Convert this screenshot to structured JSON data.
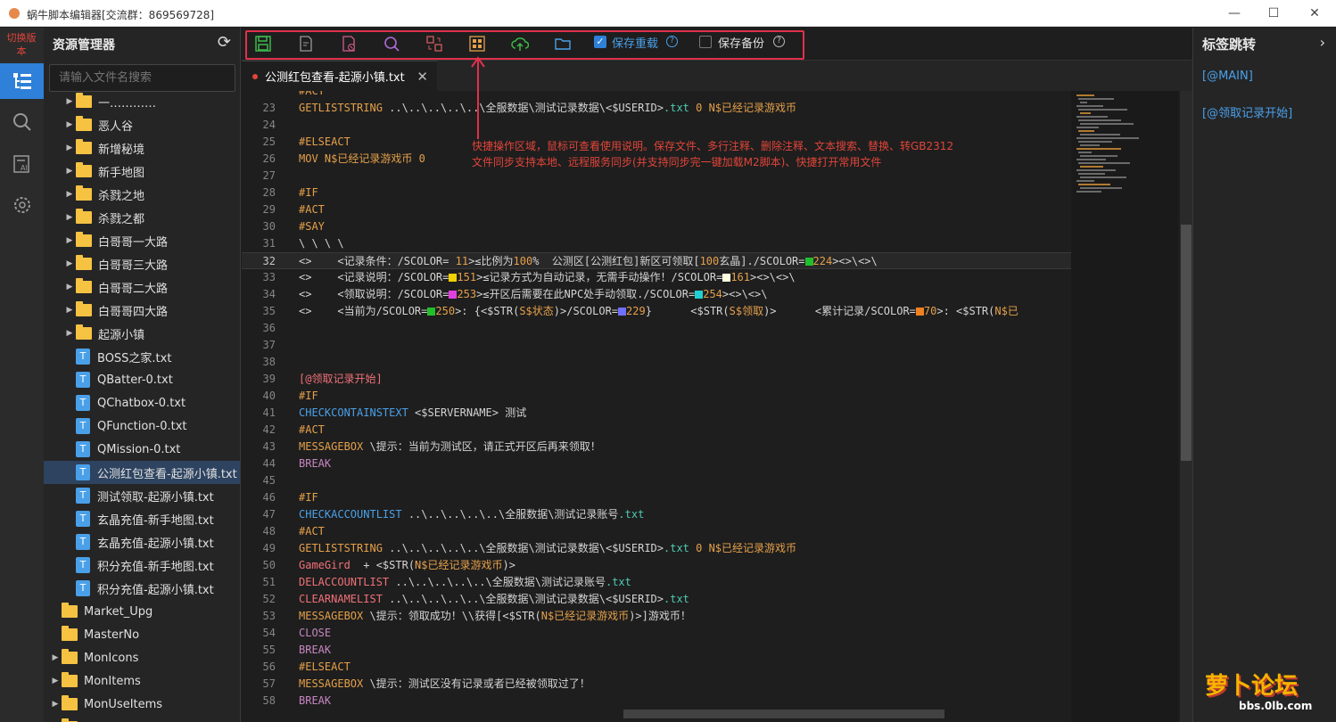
{
  "window": {
    "title": "蜗牛脚本编辑器[交流群：869569728]",
    "controls": [
      "—",
      "☐",
      "✕"
    ]
  },
  "activity": {
    "switch_label": "切换版本"
  },
  "explorer": {
    "title": "资源管理器",
    "search_placeholder": "请输入文件名搜索",
    "items": [
      {
        "label": "一…………",
        "type": "folder",
        "depth": 1,
        "expander": true
      },
      {
        "label": "恶人谷",
        "type": "folder",
        "depth": 1,
        "expander": true
      },
      {
        "label": "新增秘境",
        "type": "folder",
        "depth": 1,
        "expander": true
      },
      {
        "label": "新手地图",
        "type": "folder",
        "depth": 1,
        "expander": true
      },
      {
        "label": "杀戮之地",
        "type": "folder",
        "depth": 1,
        "expander": true
      },
      {
        "label": "杀戮之都",
        "type": "folder",
        "depth": 1,
        "expander": true
      },
      {
        "label": "白哥哥一大路",
        "type": "folder",
        "depth": 1,
        "expander": true
      },
      {
        "label": "白哥哥三大路",
        "type": "folder",
        "depth": 1,
        "expander": true
      },
      {
        "label": "白哥哥二大路",
        "type": "folder",
        "depth": 1,
        "expander": true
      },
      {
        "label": "白哥哥四大路",
        "type": "folder",
        "depth": 1,
        "expander": true
      },
      {
        "label": "起源小镇",
        "type": "folder",
        "depth": 1,
        "expander": true
      },
      {
        "label": "BOSS之家.txt",
        "type": "file",
        "depth": 1
      },
      {
        "label": "QBatter-0.txt",
        "type": "file",
        "depth": 1
      },
      {
        "label": "QChatbox-0.txt",
        "type": "file",
        "depth": 1
      },
      {
        "label": "QFunction-0.txt",
        "type": "file",
        "depth": 1
      },
      {
        "label": "QMission-0.txt",
        "type": "file",
        "depth": 1
      },
      {
        "label": "公测红包查看-起源小镇.txt",
        "type": "file",
        "depth": 1,
        "selected": true
      },
      {
        "label": "测试领取-起源小镇.txt",
        "type": "file",
        "depth": 1
      },
      {
        "label": "玄晶充值-新手地图.txt",
        "type": "file",
        "depth": 1
      },
      {
        "label": "玄晶充值-起源小镇.txt",
        "type": "file",
        "depth": 1
      },
      {
        "label": "积分充值-新手地图.txt",
        "type": "file",
        "depth": 1
      },
      {
        "label": "积分充值-起源小镇.txt",
        "type": "file",
        "depth": 1
      },
      {
        "label": "Market_Upg",
        "type": "folder",
        "depth": 0,
        "expander": false
      },
      {
        "label": "MasterNo",
        "type": "folder",
        "depth": 0,
        "expander": false
      },
      {
        "label": "MonIcons",
        "type": "folder",
        "depth": 0,
        "expander": true
      },
      {
        "label": "MonItems",
        "type": "folder",
        "depth": 0,
        "expander": true
      },
      {
        "label": "MonUseItems",
        "type": "folder",
        "depth": 0,
        "expander": true
      },
      {
        "label": "Notices",
        "type": "folder",
        "depth": 0,
        "expander": true
      }
    ]
  },
  "toolbar": {
    "icons": [
      "save-icon",
      "comment-icon",
      "delete-comment-icon",
      "search-icon",
      "replace-icon",
      "gb2312-icon",
      "upload-cloud-icon",
      "open-folder-icon"
    ],
    "save_reload": {
      "label": "保存重载",
      "checked": true
    },
    "save_backup": {
      "label": "保存备份",
      "checked": false
    }
  },
  "tab": {
    "label": "公测红包查看-起源小镇.txt",
    "modified": true
  },
  "annotation": {
    "line1": "快捷操作区域，鼠标可查看使用说明。保存文件、多行注释、删除注释、文本搜索、替换、转GB2312",
    "line2": "文件同步支持本地、远程服务同步(并支持同步完一键加载M2脚本)、快捷打开常用文件"
  },
  "colors": {
    "keyword_orange": "#e5a04a",
    "keyword_blue": "#4aa0e8",
    "keyword_purple": "#c586c0",
    "keyword_red": "#f07178",
    "text": "#d4d4d4",
    "string": "#4ec9b0",
    "accent": "#2e80d8"
  },
  "code": [
    {
      "n": "",
      "segs": [
        [
          "#ACT",
          "o"
        ]
      ]
    },
    {
      "n": "23",
      "segs": [
        [
          "GETLISTSTRING",
          "o"
        ],
        [
          " ..\\..\\..\\..\\..\\全服数据\\测试记录数据\\<$USERID>",
          "w"
        ],
        [
          ".txt ",
          "c"
        ],
        [
          "0 ",
          "o"
        ],
        [
          "N$已经记录游戏币",
          "o"
        ]
      ]
    },
    {
      "n": "24",
      "segs": []
    },
    {
      "n": "25",
      "segs": [
        [
          "#ELSEACT",
          "o"
        ]
      ]
    },
    {
      "n": "26",
      "segs": [
        [
          "MOV ",
          "o"
        ],
        [
          "N$已经记录游戏币 ",
          "o"
        ],
        [
          "0",
          "o"
        ]
      ]
    },
    {
      "n": "27",
      "segs": []
    },
    {
      "n": "28",
      "segs": [
        [
          "#IF",
          "o"
        ]
      ]
    },
    {
      "n": "29",
      "segs": [
        [
          "#ACT",
          "o"
        ]
      ]
    },
    {
      "n": "30",
      "segs": [
        [
          "#SAY",
          "o"
        ]
      ]
    },
    {
      "n": "31",
      "segs": [
        [
          "\\ \\ \\ \\",
          "w"
        ]
      ]
    },
    {
      "n": "32",
      "cur": true,
      "segs": [
        [
          "<>    <记录条件：/SCOLOR= ",
          "w"
        ],
        [
          "11",
          "o"
        ],
        [
          ">≤比例为",
          "w"
        ],
        [
          "100",
          "o"
        ],
        [
          "%  公测区[公测红包]新区可领取[",
          "w"
        ],
        [
          "100",
          "o"
        ],
        [
          "玄晶]./SCOLOR=",
          "w"
        ],
        [
          "#21c02a",
          "sq"
        ],
        [
          "224",
          "o"
        ],
        [
          "><>\\<>\\",
          "w"
        ]
      ]
    },
    {
      "n": "33",
      "segs": [
        [
          "<>    <记录说明：/SCOLOR=",
          "w"
        ],
        [
          "#f0d000",
          "sq"
        ],
        [
          "151",
          "o"
        ],
        [
          ">≤记录方式为自动记录，无需手动操作！/SCOLOR=",
          "w"
        ],
        [
          "#ffffe0",
          "sq"
        ],
        [
          "161",
          "o"
        ],
        [
          "><>\\<>\\",
          "w"
        ]
      ]
    },
    {
      "n": "34",
      "segs": [
        [
          "<>    <领取说明：/SCOLOR=",
          "w"
        ],
        [
          "#e040e0",
          "sq"
        ],
        [
          "253",
          "o"
        ],
        [
          ">≤开区后需要在此NPC处手动领取./SCOLOR=",
          "w"
        ],
        [
          "#20d0d0",
          "sq"
        ],
        [
          "254",
          "o"
        ],
        [
          "><>\\<>\\",
          "w"
        ]
      ]
    },
    {
      "n": "35",
      "segs": [
        [
          "<>    <当前为/SCOLOR=",
          "w"
        ],
        [
          "#21c02a",
          "sq"
        ],
        [
          "250",
          "o"
        ],
        [
          ">: {<$STR(",
          "w"
        ],
        [
          "S$状态",
          "o"
        ],
        [
          ")>/SCOLOR=",
          "w"
        ],
        [
          "#7070ff",
          "sq"
        ],
        [
          "229",
          "o"
        ],
        [
          "}      <$STR(",
          "w"
        ],
        [
          "S$领取",
          "o"
        ],
        [
          ")>      <累计记录/SCOLOR=",
          "w"
        ],
        [
          "#f08020",
          "sq"
        ],
        [
          "70",
          "o"
        ],
        [
          ">: <$STR(",
          "w"
        ],
        [
          "N$已",
          "o"
        ]
      ]
    },
    {
      "n": "36",
      "segs": []
    },
    {
      "n": "37",
      "segs": []
    },
    {
      "n": "38",
      "segs": []
    },
    {
      "n": "39",
      "segs": [
        [
          "[@领取记录开始]",
          "r"
        ]
      ]
    },
    {
      "n": "40",
      "segs": [
        [
          "#IF",
          "o"
        ]
      ]
    },
    {
      "n": "41",
      "segs": [
        [
          "CHECKCONTAINSTEXT",
          "b"
        ],
        [
          " <$SERVERNAME> 测试",
          "w"
        ]
      ]
    },
    {
      "n": "42",
      "segs": [
        [
          "#ACT",
          "o"
        ]
      ]
    },
    {
      "n": "43",
      "segs": [
        [
          "MESSAGEBOX",
          "o"
        ],
        [
          " \\提示：当前为测试区，请正式开区后再来领取！",
          "w"
        ]
      ]
    },
    {
      "n": "44",
      "segs": [
        [
          "BREAK",
          "p"
        ]
      ]
    },
    {
      "n": "45",
      "segs": []
    },
    {
      "n": "46",
      "segs": [
        [
          "#IF",
          "o"
        ]
      ]
    },
    {
      "n": "47",
      "segs": [
        [
          "CHECKACCOUNTLIST",
          "b"
        ],
        [
          " ..\\..\\..\\..\\..\\全服数据\\测试记录账号",
          "w"
        ],
        [
          ".txt",
          "c"
        ]
      ]
    },
    {
      "n": "48",
      "segs": [
        [
          "#ACT",
          "o"
        ]
      ]
    },
    {
      "n": "49",
      "segs": [
        [
          "GETLISTSTRING",
          "o"
        ],
        [
          " ..\\..\\..\\..\\..\\全服数据\\测试记录数据\\<$USERID>",
          "w"
        ],
        [
          ".txt ",
          "c"
        ],
        [
          "0 ",
          "o"
        ],
        [
          "N$已经记录游戏币",
          "o"
        ]
      ]
    },
    {
      "n": "50",
      "segs": [
        [
          "GameGird",
          "r"
        ],
        [
          "  + <$STR(",
          "w"
        ],
        [
          "N$已经记录游戏币",
          "o"
        ],
        [
          ")>",
          "w"
        ]
      ]
    },
    {
      "n": "51",
      "segs": [
        [
          "DELACCOUNTLIST",
          "r"
        ],
        [
          " ..\\..\\..\\..\\..\\全服数据\\测试记录账号",
          "w"
        ],
        [
          ".txt",
          "c"
        ]
      ]
    },
    {
      "n": "52",
      "segs": [
        [
          "CLEARNAMELIST",
          "r"
        ],
        [
          " ..\\..\\..\\..\\..\\全服数据\\测试记录数据\\<$USERID>",
          "w"
        ],
        [
          ".txt",
          "c"
        ]
      ]
    },
    {
      "n": "53",
      "segs": [
        [
          "MESSAGEBOX",
          "o"
        ],
        [
          " \\提示：领取成功！\\\\获得[<$STR(",
          "w"
        ],
        [
          "N$已经记录游戏币",
          "o"
        ],
        [
          ")>]游戏币！",
          "w"
        ]
      ]
    },
    {
      "n": "54",
      "segs": [
        [
          "CLOSE",
          "p"
        ]
      ]
    },
    {
      "n": "55",
      "segs": [
        [
          "BREAK",
          "p"
        ]
      ]
    },
    {
      "n": "56",
      "segs": [
        [
          "#ELSEACT",
          "o"
        ]
      ]
    },
    {
      "n": "57",
      "segs": [
        [
          "MESSAGEBOX",
          "o"
        ],
        [
          " \\提示：测试区没有记录或者已经被领取过了！",
          "w"
        ]
      ]
    },
    {
      "n": "58",
      "segs": [
        [
          "BREAK",
          "p"
        ]
      ]
    }
  ],
  "bookmarks": {
    "title": "标签跳转",
    "items": [
      "[@MAIN]",
      "[@领取记录开始]"
    ]
  },
  "watermark": {
    "text": "萝卜论坛",
    "url": "bbs.0lb.com"
  }
}
